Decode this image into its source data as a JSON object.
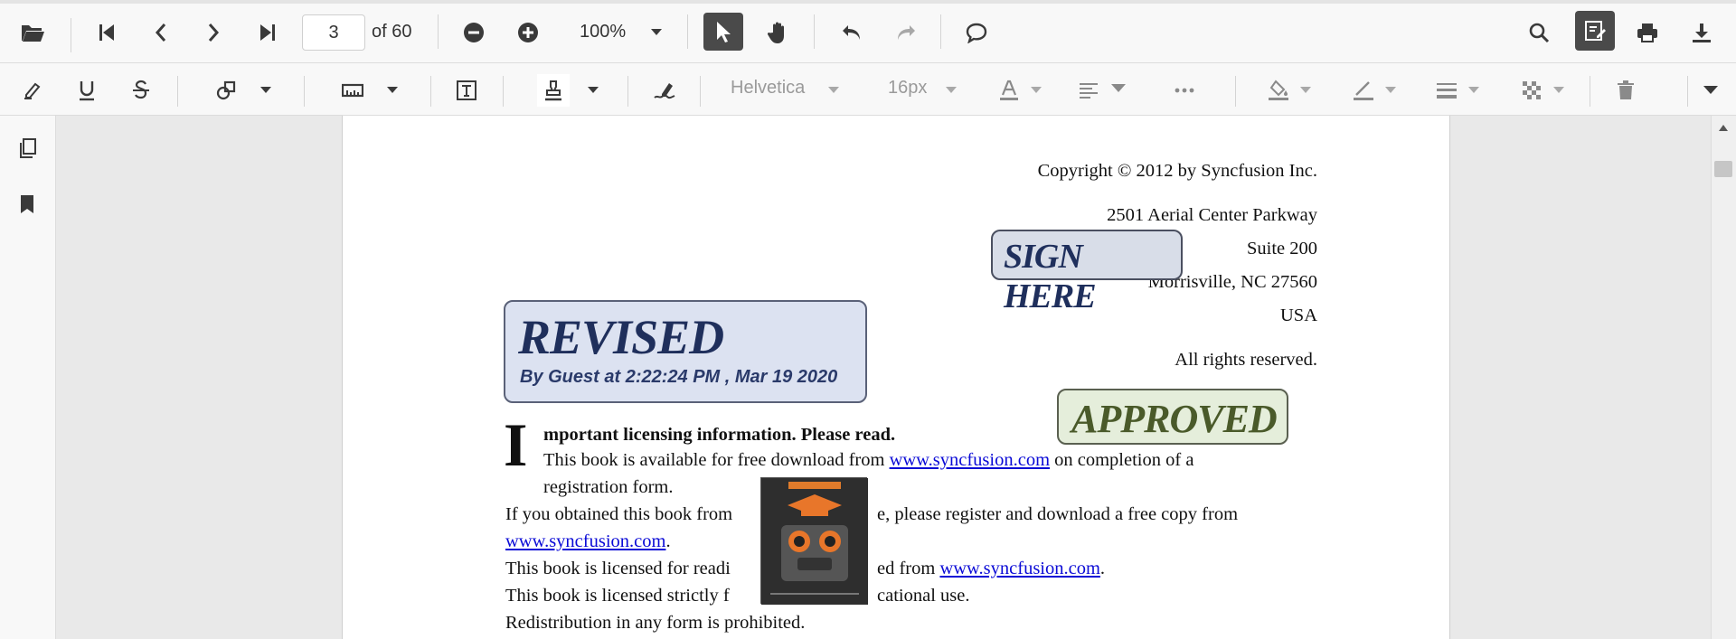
{
  "toolbar": {
    "page_current": "3",
    "page_of": "of 60",
    "zoom": "100%"
  },
  "annotation_toolbar": {
    "font_family": "Helvetica",
    "font_size": "16px"
  },
  "document": {
    "copyright": "Copyright © 2012 by Syncfusion Inc.",
    "address": [
      "2501 Aerial Center Parkway",
      "Suite 200",
      "Morrisville, NC 27560",
      "USA"
    ],
    "rights": "All rights reserved.",
    "heading_initial": "I",
    "heading_rest": "mportant licensing information. Please read.",
    "p1_a": "This book is available for free download from ",
    "p1_link": "www.syncfusion.com",
    "p1_b": " on completion of a",
    "p1_c": "registration form.",
    "p2_a": "If you obtained this book from",
    "p2_b": "e, please register and download a free copy from",
    "p2_link": "www.syncfusion.com",
    "p2_c": ".",
    "p3_a": "This book is licensed for readi",
    "p3_b": "ed from ",
    "p3_link": "www.syncfusion.com",
    "p3_c": ".",
    "p4_a": "This book is licensed strictly f",
    "p4_b": "cational use.",
    "p5": "Redistribution in any form is prohibited."
  },
  "stamps": {
    "revised_title": "REVISED",
    "revised_sub": "By Guest at 2:22:24 PM , Mar 19 2020",
    "sign_here": "SIGN HERE",
    "approved": "APPROVED"
  },
  "colors": {
    "accent_active": "#4a4a4a",
    "revised_bg": "#dce2f1",
    "revised_text": "#1f2f5c",
    "approved_bg": "#e5eedb",
    "approved_text": "#4a5a2a",
    "link": "#0a0ad6"
  }
}
